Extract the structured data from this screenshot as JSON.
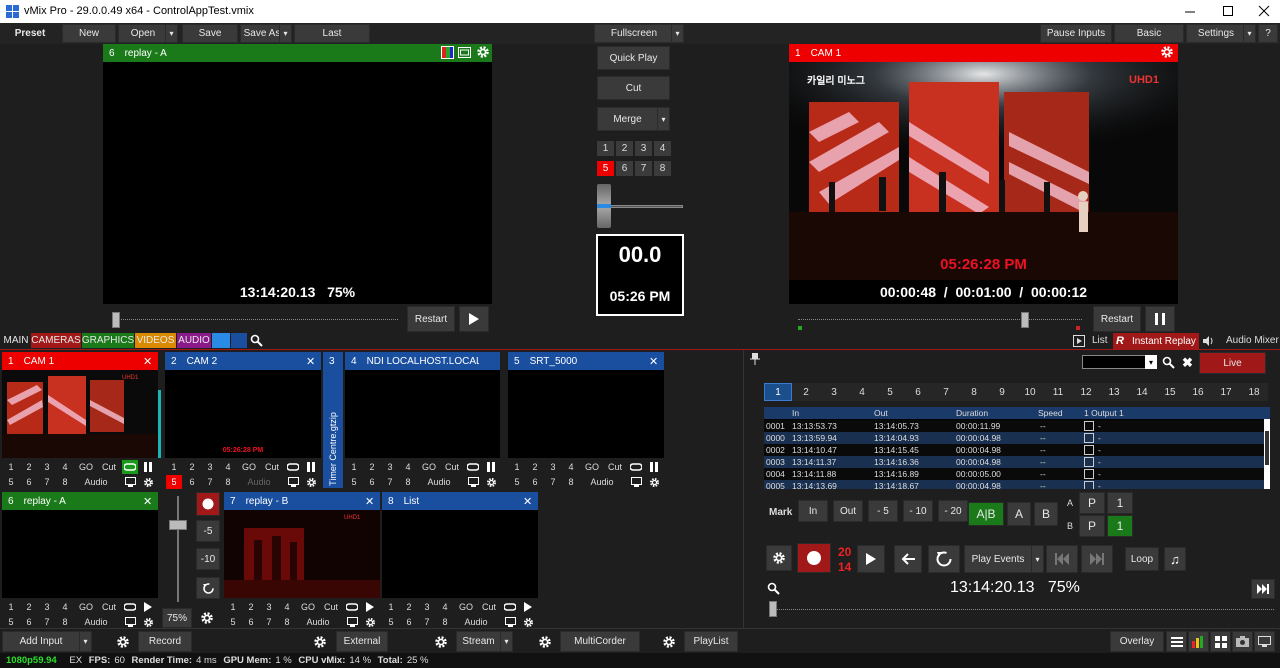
{
  "window": {
    "title": "vMix Pro - 29.0.0.49 x64 - ControlAppTest.vmix"
  },
  "menu": {
    "preset": "Preset",
    "new": "New",
    "open": "Open",
    "save": "Save",
    "save_as": "Save As",
    "last": "Last",
    "fullscreen": "Fullscreen",
    "pause_inputs": "Pause Inputs",
    "basic": "Basic",
    "settings": "Settings",
    "help": "?"
  },
  "preview": {
    "number": "6",
    "name": "replay - A",
    "timecode": "13:14:20.13",
    "zoom": "75%",
    "restart": "Restart",
    "position": 0.0
  },
  "output": {
    "number": "1",
    "name": "CAM 1",
    "overlay_top_left": "카일리 미노그",
    "overlay_top_right": "UHD1",
    "overlay_time": "05:26:28 PM",
    "elapsed": "00:00:48",
    "duration": "00:01:00",
    "remaining": "00:00:12",
    "restart": "Restart",
    "position": 0.8
  },
  "transitions": {
    "quick_play": "Quick Play",
    "cut": "Cut",
    "merge": "Merge",
    "numbers": [
      "1",
      "2",
      "3",
      "4",
      "5",
      "6",
      "7",
      "8"
    ],
    "active": "5",
    "tbar": 0.0
  },
  "clock": {
    "countdown": "00.0",
    "time": "05:26 PM"
  },
  "categories": {
    "main": "MAIN",
    "cameras": "CAMERAS",
    "graphics": "GRAPHICS",
    "videos": "VIDEOS",
    "audio": "AUDIO",
    "main_color": "#1e1e1e",
    "cameras_color": "#a01818",
    "graphics_color": "#1a7a1a",
    "videos_color": "#d98a00",
    "audio_color": "#8a1a8a"
  },
  "inputs": {
    "i1": {
      "number": "1",
      "name": "CAM 1"
    },
    "i2": {
      "number": "2",
      "name": "CAM 2",
      "overlay": "05:26:28 PM",
      "audio": "Audio"
    },
    "i3": {
      "number": "3",
      "name": "Timer Centre.gtzip"
    },
    "i4": {
      "number": "4",
      "name": "NDI LOCALHOST.LOCALDOMAIN"
    },
    "i5": {
      "number": "5",
      "name": "SRT_5000"
    },
    "i6": {
      "number": "6",
      "name": "replay - A"
    },
    "i7": {
      "number": "7",
      "name": "replay - B"
    },
    "i8": {
      "number": "8",
      "name": "List"
    },
    "go": "GO",
    "cut": "Cut",
    "audio": "Audio",
    "nums": [
      "1",
      "2",
      "3",
      "4",
      "5",
      "6",
      "7",
      "8"
    ]
  },
  "replay_controls": {
    "minus5": "-5",
    "minus10": "-10",
    "zoom": "75%"
  },
  "panel_tabs": {
    "list": "List",
    "instant_replay": "Instant Replay",
    "audio_mixer": "Audio Mixer"
  },
  "replay": {
    "live": "Live",
    "camera_tabs": [
      "1",
      "2",
      "3",
      "4",
      "5",
      "6",
      "7",
      "8",
      "9",
      "10",
      "11",
      "12",
      "13",
      "14",
      "15",
      "16",
      "17",
      "18"
    ],
    "selected_tab": "1",
    "columns": {
      "in": "In",
      "out": "Out",
      "duration": "Duration",
      "speed": "Speed",
      "outputs": "1 Output 1"
    },
    "events": [
      {
        "id": "0001",
        "in": "13:13:53.73",
        "out": "13:14:05.73",
        "duration": "00:00:11.99",
        "speed": "--",
        "cam": "-"
      },
      {
        "id": "0000",
        "in": "13:13:59.94",
        "out": "13:14:04.93",
        "duration": "00:00:04.98",
        "speed": "--",
        "cam": "-"
      },
      {
        "id": "0002",
        "in": "13:14:10.47",
        "out": "13:14:15.45",
        "duration": "00:00:04.98",
        "speed": "--",
        "cam": "-"
      },
      {
        "id": "0003",
        "in": "13:14:11.37",
        "out": "13:14:16.36",
        "duration": "00:00:04.98",
        "speed": "--",
        "cam": "-"
      },
      {
        "id": "0004",
        "in": "13:14:11.88",
        "out": "13:14:16.89",
        "duration": "00:00:05.00",
        "speed": "--",
        "cam": "-"
      },
      {
        "id": "0005",
        "in": "13:14:13.69",
        "out": "13:14:18.67",
        "duration": "00:00:04.98",
        "speed": "--",
        "cam": "-"
      }
    ],
    "mark": "Mark",
    "in_btn": "In",
    "out_btn": "Out",
    "m5": "- 5",
    "m10": "- 10",
    "m20": "- 20",
    "ab": "A|B",
    "a": "A",
    "b": "B",
    "label_a": "A",
    "label_b": "B",
    "p": "P",
    "out_a": "1",
    "out_b": "1",
    "speed_top": "20",
    "speed_bottom": "14",
    "play_events": "Play Events",
    "loop": "Loop",
    "timecode": "13:14:20.13",
    "zoom": "75%"
  },
  "bottom": {
    "add_input": "Add Input",
    "record": "Record",
    "external": "External",
    "stream": "Stream",
    "multicorder": "MultiCorder",
    "playlist": "PlayList",
    "overlay": "Overlay"
  },
  "status": {
    "format": "1080p59.94",
    "ex": "EX",
    "fps_label": "FPS:",
    "fps": "60",
    "render_label": "Render Time:",
    "render": "4 ms",
    "gpu_label": "GPU Mem:",
    "gpu": "1 %",
    "cpu_label": "CPU vMix:",
    "cpu": "14 %",
    "total_label": "Total:",
    "total": "25 %"
  }
}
